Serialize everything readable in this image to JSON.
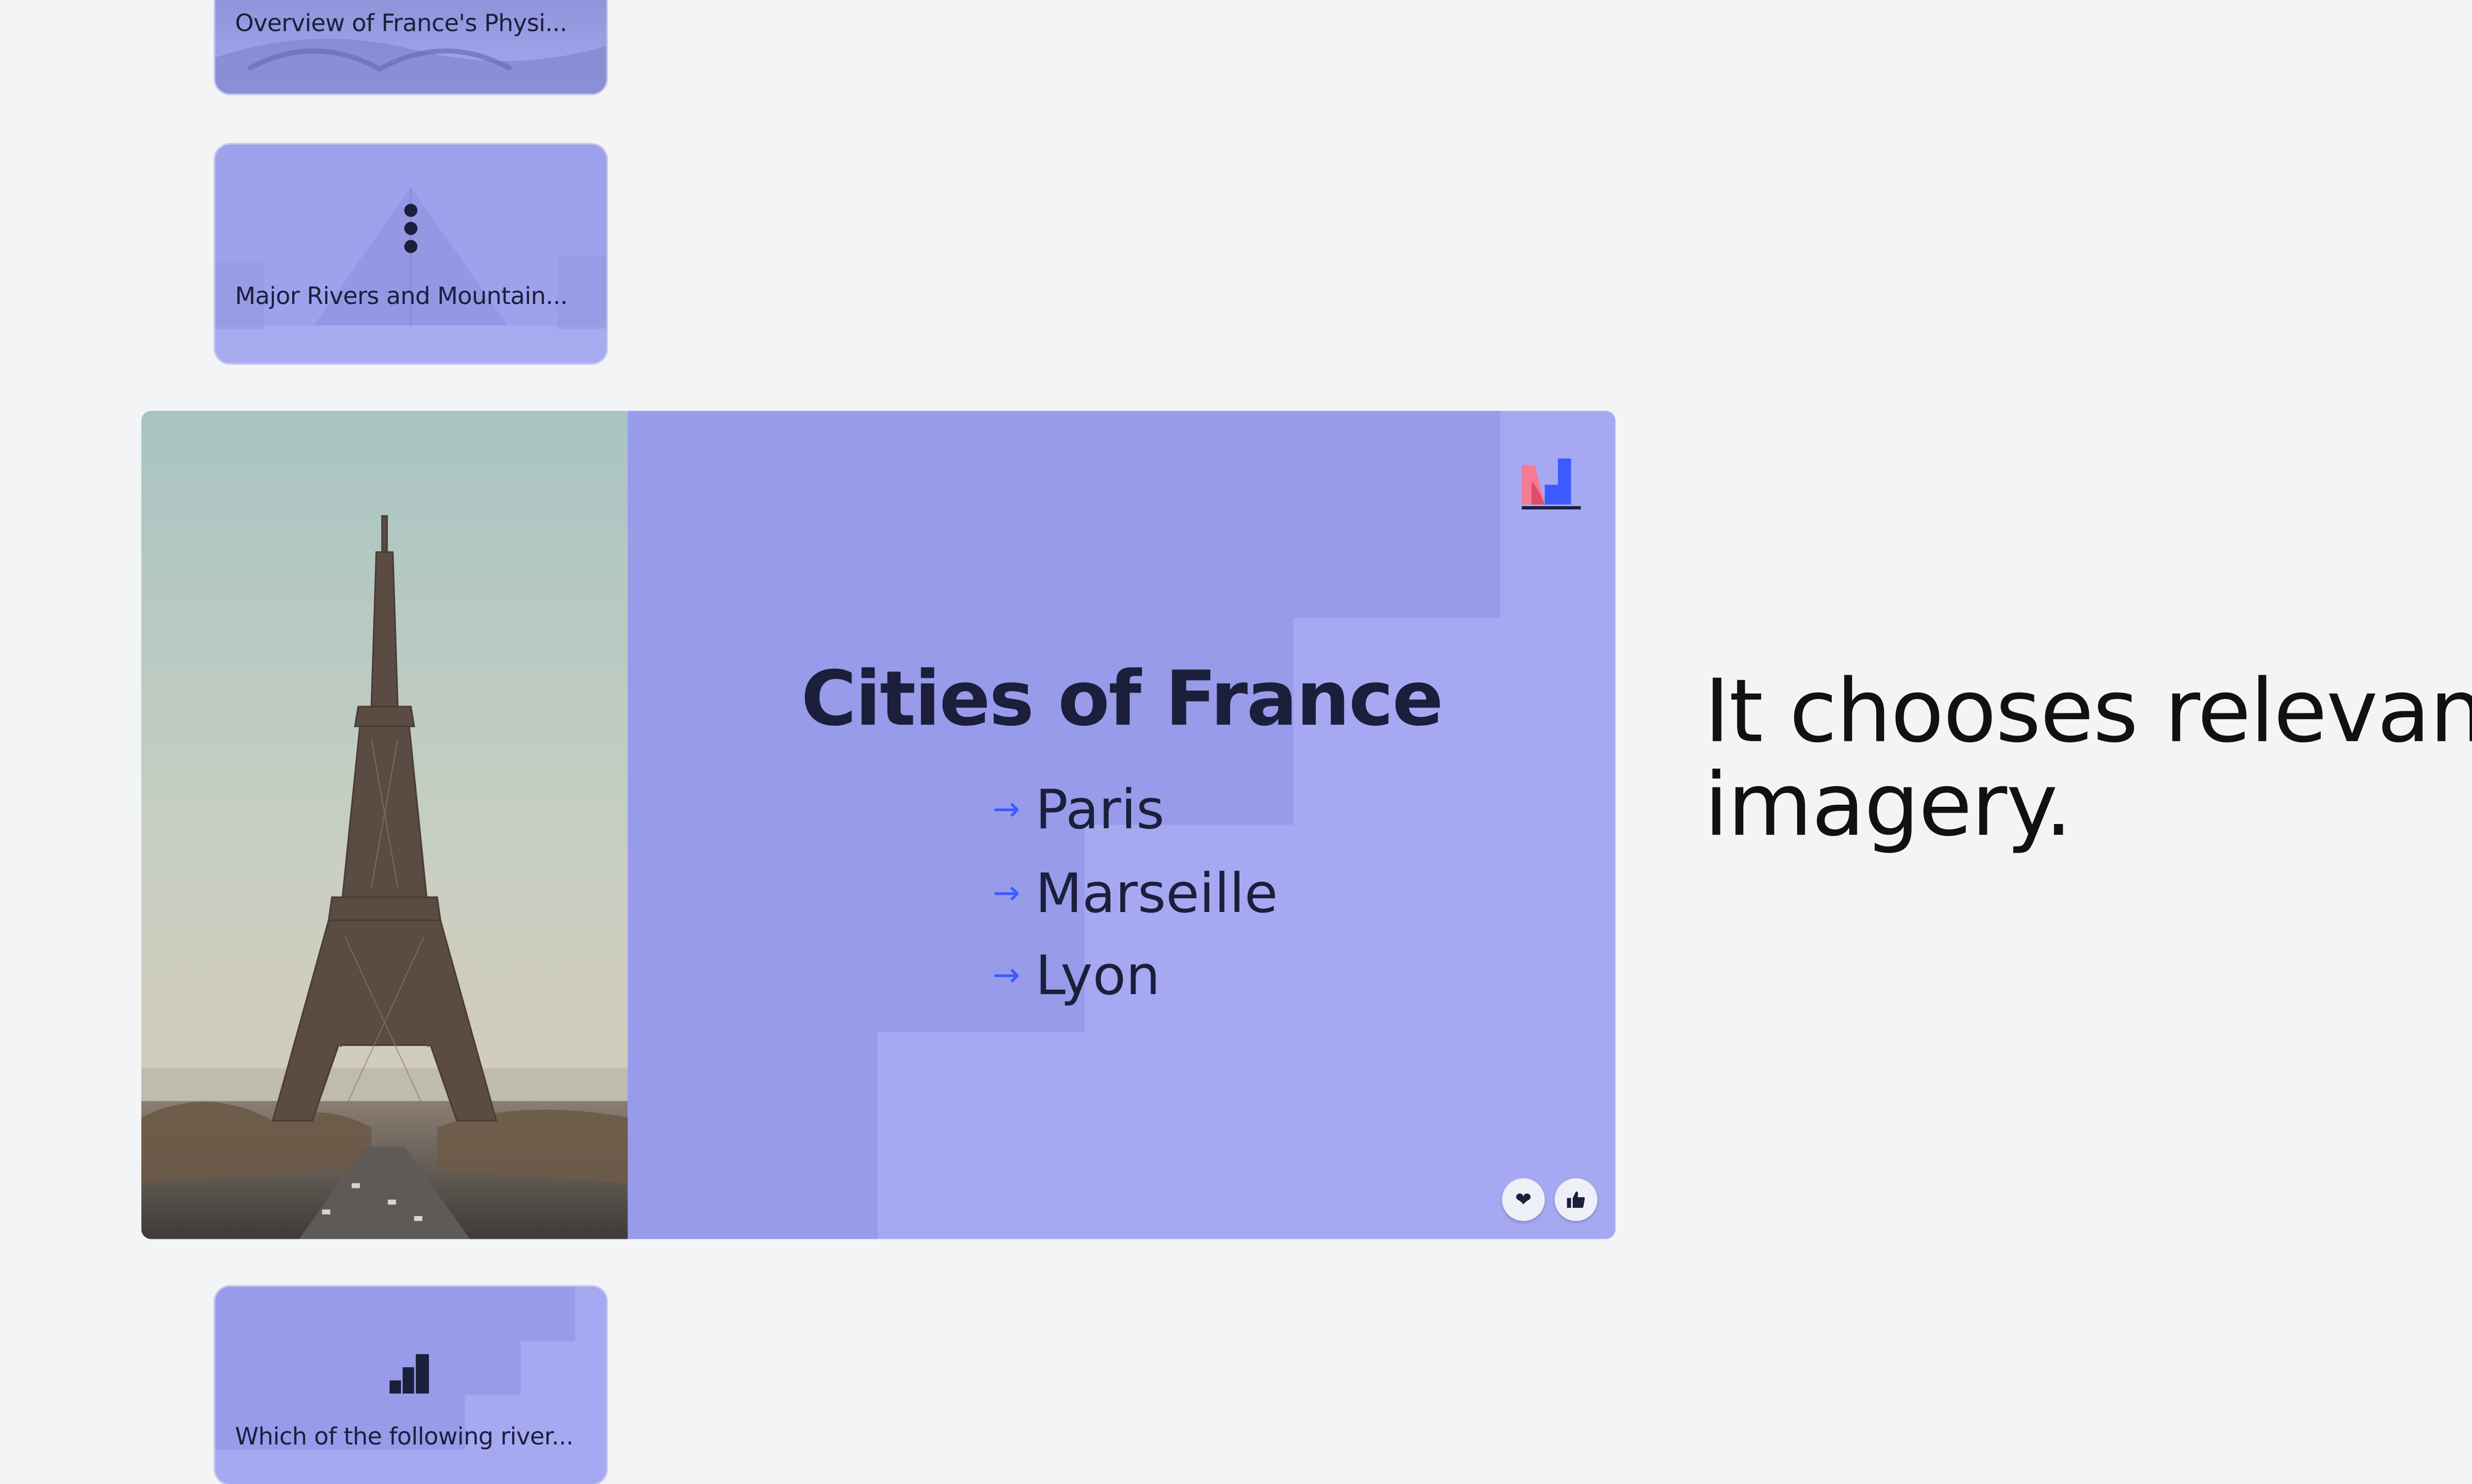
{
  "thumbnails": [
    {
      "title": "Overview of France's Physi..."
    },
    {
      "title": "Major Rivers and Mountain..."
    },
    {
      "title": "Which of the following river..."
    }
  ],
  "slide": {
    "title": "Cities of France",
    "bullets": [
      "Paris",
      "Marseille",
      "Lyon"
    ],
    "bullet_icon": "arrow-right-icon",
    "reactions": [
      "heart-icon",
      "thumbs-up-icon"
    ]
  },
  "caption": {
    "text": "It chooses relevant imagery."
  },
  "colors": {
    "background": "#f3f4f6",
    "slide_light": "#a6a9f2",
    "slide_dark": "#989be9",
    "text_dark": "#1b1f3b",
    "accent_blue": "#3d5afe",
    "accent_pink": "#f47b92"
  }
}
